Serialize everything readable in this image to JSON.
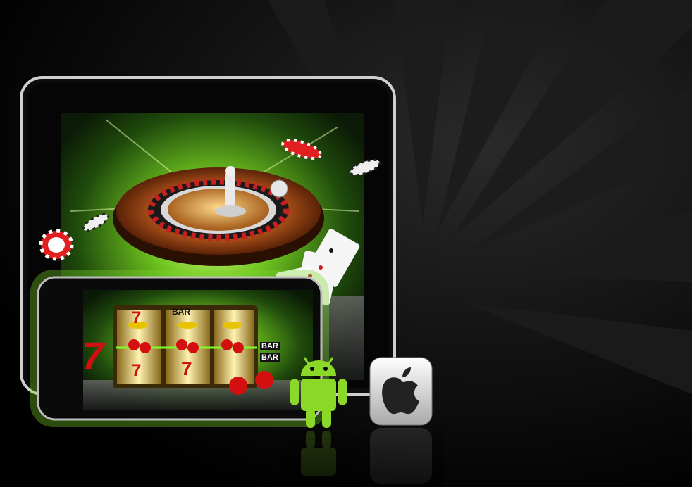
{
  "scene": {
    "background": "#000000",
    "accent_green": "#7cd62a",
    "chip_red": "#e02020",
    "icons": [
      "roulette-wheel-icon",
      "slot-machine-icon",
      "playing-cards-icon",
      "casino-chip-icon",
      "android-icon",
      "apple-icon"
    ]
  },
  "slot": {
    "bar_label": "BAR",
    "bar_label_small_top": "BAR",
    "bar_label_small_bottom": "BAR",
    "seven": "7"
  }
}
